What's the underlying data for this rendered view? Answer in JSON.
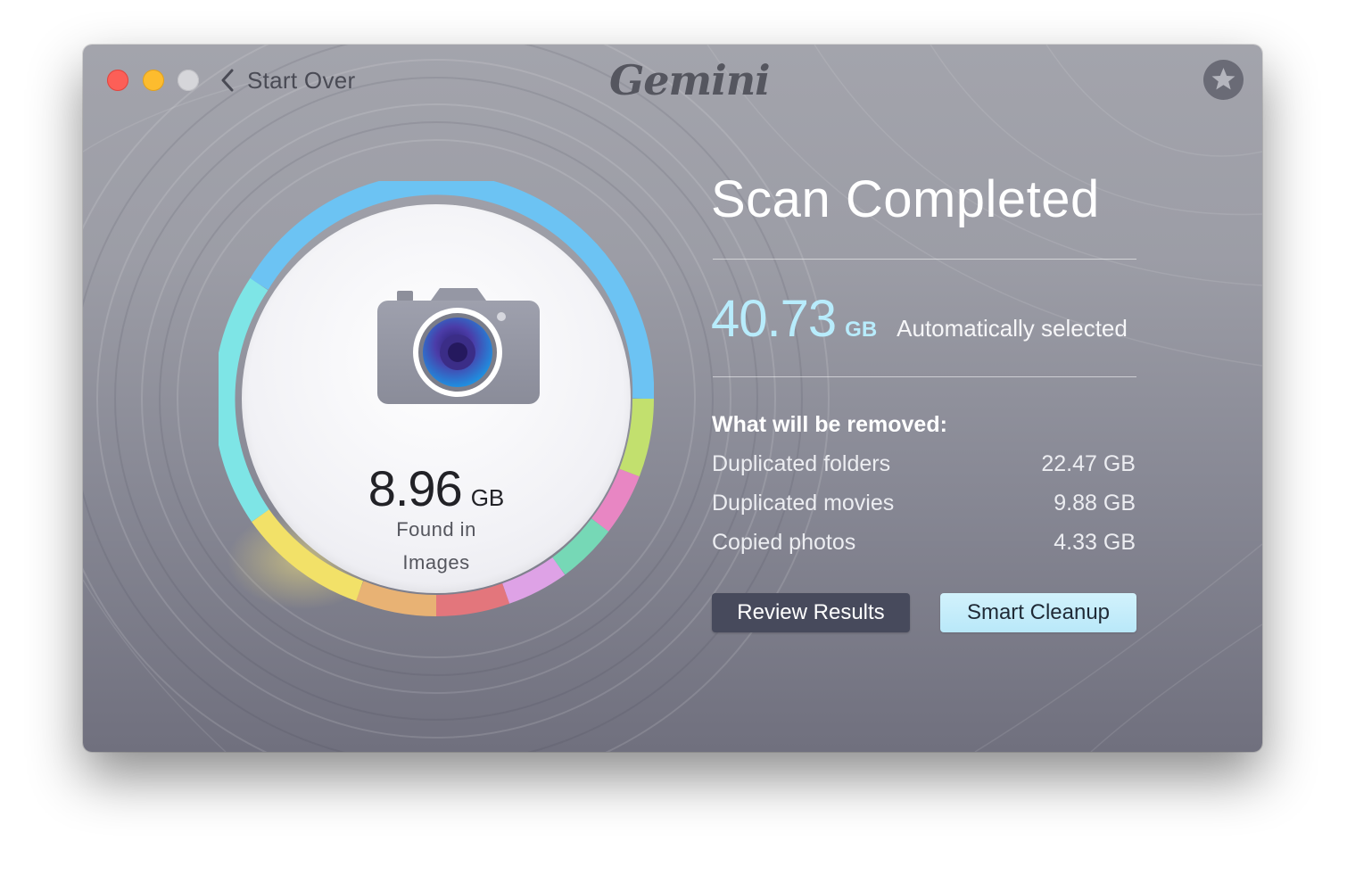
{
  "window": {
    "title_logo": "Gemini",
    "start_over_label": "Start Over"
  },
  "titlebar_icons": [
    "close-button",
    "minimize-button",
    "zoom-button",
    "chevron-left-icon",
    "star-icon"
  ],
  "ring_chart": {
    "found_value": "8.96",
    "found_unit": "GB",
    "found_line1": "Found in",
    "found_line2": "Images",
    "center_icon": "camera-icon"
  },
  "panel": {
    "title": "Scan Completed",
    "total_value": "40.73",
    "total_unit": "GB",
    "total_label": "Automatically selected",
    "removed_heading": "What will be removed:",
    "items": [
      {
        "name": "Duplicated folders",
        "size": "22.47 GB"
      },
      {
        "name": "Duplicated movies",
        "size": "9.88 GB"
      },
      {
        "name": "Copied photos",
        "size": "4.33 GB"
      }
    ],
    "review_button": "Review Results",
    "cleanup_button": "Smart Cleanup"
  },
  "colors": {
    "accent_blue": "#6cc3f3",
    "cleanup_button": "#c7eefb",
    "review_button": "#474a5c",
    "total_value": "#b8ecfc"
  }
}
